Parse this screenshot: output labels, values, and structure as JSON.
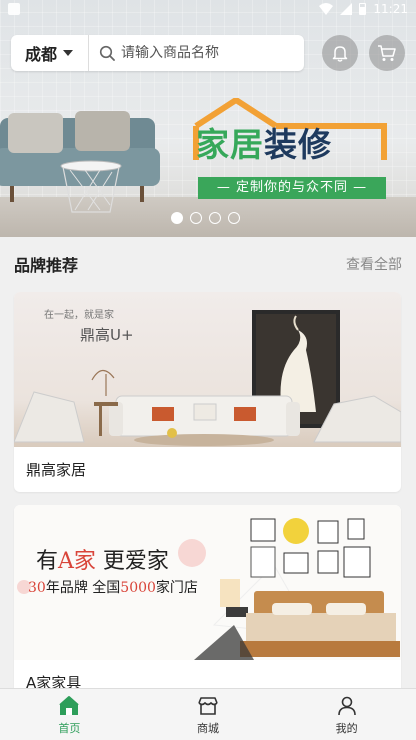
{
  "status_bar": {
    "time": "11:21"
  },
  "search_bar": {
    "city": "成都",
    "placeholder": "请输入商品名称"
  },
  "banner": {
    "logo_part1": "家居",
    "logo_part2": "装修",
    "slogan": "— 定制你的与众不同 —",
    "slide_count": 4,
    "active_slide": 0
  },
  "section": {
    "title": "品牌推荐",
    "more_label": "查看全部"
  },
  "brands": [
    {
      "name": "鼎高家居",
      "ad_tagline": "在一起，就是家",
      "ad_brand": "鼎高U+"
    },
    {
      "name": "A家家具",
      "ad_line1_a": "有",
      "ad_line1_b": "A家",
      "ad_line1_c": " 更爱家",
      "ad_line2_a": "30",
      "ad_line2_b": "年品牌 全国",
      "ad_line2_c": "5000",
      "ad_line2_d": "家门店"
    }
  ],
  "bottom_nav": [
    {
      "label": "首页",
      "icon": "home-icon",
      "active": true
    },
    {
      "label": "商城",
      "icon": "store-icon",
      "active": false
    },
    {
      "label": "我的",
      "icon": "user-icon",
      "active": false
    }
  ],
  "colors": {
    "accent": "#2e9e5a",
    "logo_navy": "#1e3a5e",
    "ad_red": "#d9453a"
  }
}
